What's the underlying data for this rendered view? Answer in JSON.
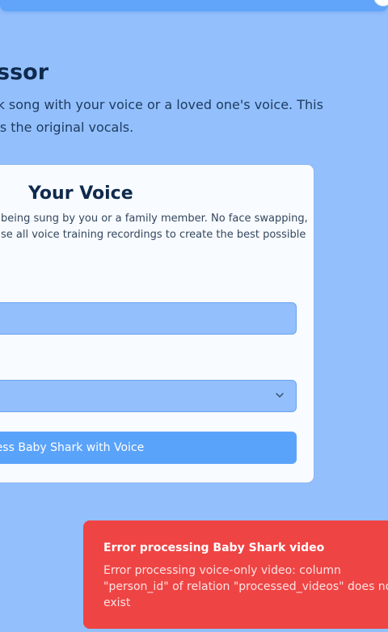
{
  "header": {
    "title": "ssor",
    "intro_line1": "rk song with your voice or a loved one's voice. This",
    "intro_line2": "es the original vocals."
  },
  "card": {
    "title": "Your Voice",
    "desc_line1": "being sung by you or a family member. No face swapping,",
    "desc_line2": "se all voice training recordings to create the best possible",
    "name_input": {
      "value": "",
      "placeholder": ""
    },
    "select": {
      "selected": ""
    },
    "submit_label": "cess Baby Shark with Voice"
  },
  "toast": {
    "title": "Error processing Baby Shark video",
    "msg_line1": "Error processing voice-only video: column",
    "msg_line2": "\"person_id\" of relation \"processed_videos\" does not",
    "msg_line3": "exist"
  },
  "icons": {
    "select_chevron": "chevron-down-icon"
  },
  "colors": {
    "background": "#93c0fd",
    "card": "#f8fbff",
    "button": "#5aa3fb",
    "toast": "#ef4444"
  }
}
